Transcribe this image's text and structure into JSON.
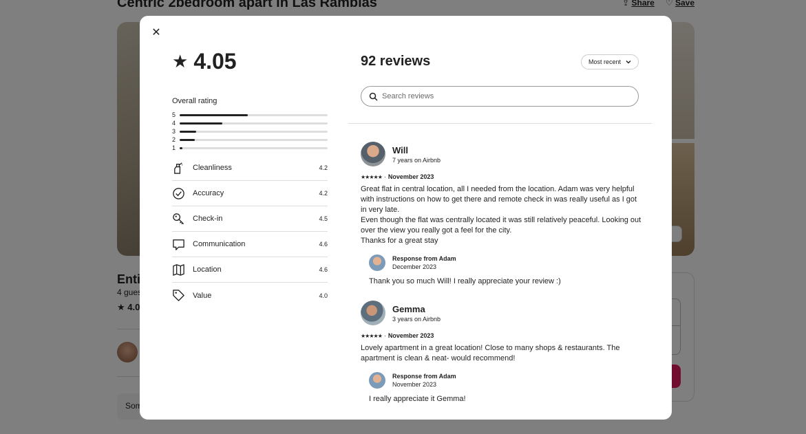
{
  "background": {
    "listing_title": "Centric 2bedroom apart in Las Ramblas",
    "share_label": "Share",
    "save_label": "Save",
    "heading_partial": "Entir",
    "guests_partial": "4 gues",
    "rating_partial": "4.0",
    "some_partial": "Som"
  },
  "modal": {
    "overall_score": "4.05",
    "overall_label": "Overall rating",
    "distribution": [
      {
        "stars": "5",
        "fraction": 0.46
      },
      {
        "stars": "4",
        "fraction": 0.29
      },
      {
        "stars": "3",
        "fraction": 0.11
      },
      {
        "stars": "2",
        "fraction": 0.1
      },
      {
        "stars": "1",
        "fraction": 0.02
      }
    ],
    "categories": [
      {
        "icon": "spray-bottle-icon",
        "label": "Cleanliness",
        "value": "4.2"
      },
      {
        "icon": "check-circle-icon",
        "label": "Accuracy",
        "value": "4.2"
      },
      {
        "icon": "key-icon",
        "label": "Check-in",
        "value": "4.5"
      },
      {
        "icon": "chat-bubble-icon",
        "label": "Communication",
        "value": "4.6"
      },
      {
        "icon": "map-icon",
        "label": "Location",
        "value": "4.6"
      },
      {
        "icon": "tag-icon",
        "label": "Value",
        "value": "4.0"
      }
    ],
    "reviews_title": "92 reviews",
    "sort_label": "Most recent",
    "search_placeholder": "Search reviews",
    "reviews": [
      {
        "name": "Will",
        "since": "7 years on Airbnb",
        "stars": "★★★★★",
        "date": "November 2023",
        "text": "Great flat in central location, all I needed from the location. Adam was very helpful with instructions on how to get there and remote check in was really useful as I got in very late.\nEven though the flat was centrally located it was still relatively peaceful. Looking out over the view you really got a feel for the city.\nThanks for a great stay",
        "response_from": "Response from Adam",
        "response_date": "December 2023",
        "response_text": "Thank you so much Will! I really appreciate your review :)"
      },
      {
        "name": "Gemma",
        "since": "3 years on Airbnb",
        "stars": "★★★★★",
        "date": "November 2023",
        "text": "Lovely apartment in a great location! Close to many shops & restaurants. The apartment is clean & neat- would recommend!",
        "response_from": "Response from Adam",
        "response_date": "November 2023",
        "response_text": "I really appreciate it Gemma!"
      }
    ]
  }
}
